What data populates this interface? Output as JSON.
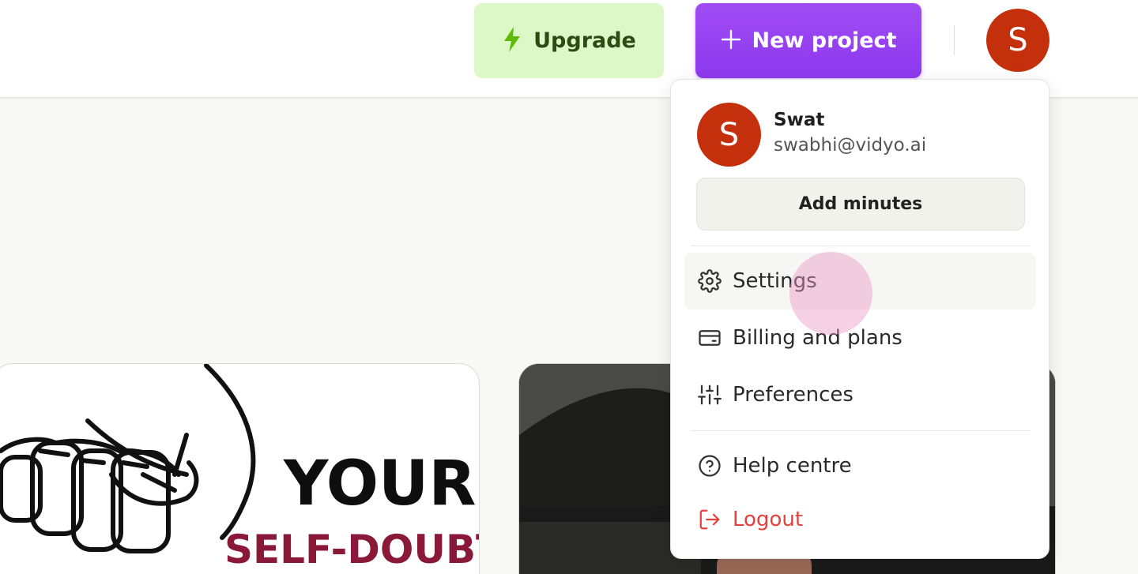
{
  "header": {
    "upgrade_label": "Upgrade",
    "new_project_label": "New project",
    "avatar_initial": "S"
  },
  "cards": {
    "card1": {
      "text_top": "YOUR",
      "text_bottom": "SELF-DOUBT"
    }
  },
  "user_menu": {
    "avatar_initial": "S",
    "name": "Swat",
    "email": "swabhi@vidyo.ai",
    "add_minutes_label": "Add minutes",
    "items": [
      {
        "label": "Settings",
        "icon": "gear-icon",
        "active": true
      },
      {
        "label": "Billing and plans",
        "icon": "credit-card-icon"
      },
      {
        "label": "Preferences",
        "icon": "sliders-icon"
      },
      {
        "label": "Help centre",
        "icon": "help-circle-icon"
      },
      {
        "label": "Logout",
        "icon": "logout-icon",
        "color": "#e5413d"
      }
    ]
  },
  "colors": {
    "upgrade_bg": "#dcf8c6",
    "upgrade_accent": "#5fb90a",
    "new_project_bg": "#8d38ee",
    "avatar_bg": "#c4300c",
    "logout": "#e5413d",
    "card1_text_bottom": "#8a1838"
  }
}
